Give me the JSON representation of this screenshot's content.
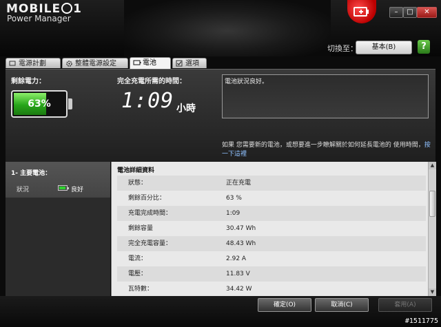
{
  "app": {
    "logo_text_a": "MOBILE",
    "logo_text_b": "1",
    "title": "Power Manager"
  },
  "header": {
    "switch_label": "切換至：",
    "profile_value": "基本(B)",
    "help_label": "?"
  },
  "tabs": [
    {
      "label": "電源計劃"
    },
    {
      "label": "整體電源設定"
    },
    {
      "label": "電池"
    },
    {
      "label": "選項"
    }
  ],
  "battery": {
    "remaining_label": "剩餘電力：",
    "percent_text": "63%",
    "percent": 63,
    "fulltime_label": "完全充電所需的時間：",
    "time_value": "1:09",
    "time_unit": "小時",
    "status_text": "電池狀況良好。",
    "tip_text": "如果 您需要新的電池，或想要進一步瞭解關於如何延長電池的 使用時間，",
    "tip_link": "按一下這裡"
  },
  "left_list": {
    "item_name": "1- 主要電池：",
    "status_label": "狀況",
    "status_value": "良好"
  },
  "details": {
    "title": "電池詳細資料",
    "rows": [
      {
        "key": "狀態：",
        "value": "正在充電"
      },
      {
        "key": "剩餘百分比：",
        "value": "63 %"
      },
      {
        "key": "充電完成時間：",
        "value": "1:09"
      },
      {
        "key": "剩餘容量",
        "value": "30.47 Wh"
      },
      {
        "key": "完全充電容量：",
        "value": "48.43 Wh"
      },
      {
        "key": "電流：",
        "value": "2.92 A"
      },
      {
        "key": "電壓：",
        "value": "11.83 V"
      },
      {
        "key": "瓦特數：",
        "value": "34.42 W"
      }
    ]
  },
  "buttons": {
    "ok": "確定(O)",
    "cancel": "取消(C)",
    "apply": "套用(A)"
  },
  "watermark": "#1511775",
  "colors": {
    "accent_green": "#27a51a",
    "link_blue": "#8fc1ff",
    "badge_red": "#d9534f"
  }
}
